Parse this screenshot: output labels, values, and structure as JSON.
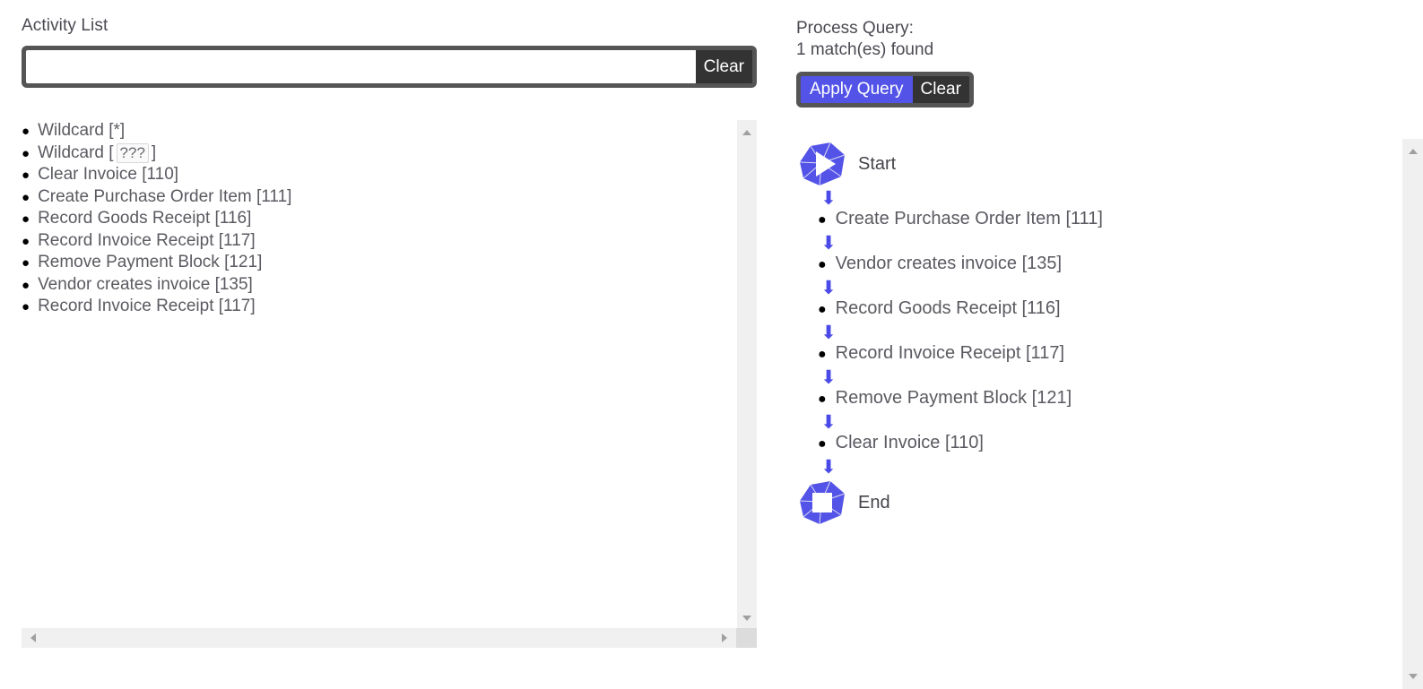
{
  "left": {
    "title": "Activity List",
    "search": {
      "value": "",
      "placeholder": "",
      "clear_label": "Clear"
    },
    "items": [
      {
        "label": "Wildcard [*]",
        "type": "wildcard-star"
      },
      {
        "label": "Wildcard [ ??? ]",
        "type": "wildcard-token",
        "prefix": "Wildcard [",
        "token": "???",
        "suffix": "]"
      },
      {
        "label": "Clear Invoice [110]",
        "type": "activity"
      },
      {
        "label": "Create Purchase Order Item [111]",
        "type": "activity"
      },
      {
        "label": "Record Goods Receipt [116]",
        "type": "activity"
      },
      {
        "label": "Record Invoice Receipt [117]",
        "type": "activity"
      },
      {
        "label": "Remove Payment Block [121]",
        "type": "activity"
      },
      {
        "label": "Vendor creates invoice [135]",
        "type": "activity"
      },
      {
        "label": "Record Invoice Receipt [117]",
        "type": "activity"
      }
    ]
  },
  "right": {
    "query_title_line1": "Process Query:",
    "query_title_line2": "1 match(es) found",
    "match_count": 1,
    "apply_label": "Apply Query",
    "clear_label": "Clear",
    "graph": {
      "start_label": "Start",
      "end_label": "End",
      "start_icon": "play-polygon-icon",
      "end_icon": "stop-polygon-icon",
      "arrow_glyph": "⬇",
      "nodes": [
        "Create Purchase Order Item [111]",
        "Vendor creates invoice [135]",
        "Record Goods Receipt [116]",
        "Record Invoice Receipt [117]",
        "Remove Payment Block [121]",
        "Clear Invoice [110]"
      ]
    }
  },
  "colors": {
    "accent_blue": "#5353e8",
    "toolbar_gray": "#555555",
    "button_dark": "#333333",
    "text_gray": "#5a5a61",
    "scrollbar_track": "#f0f0f0"
  }
}
